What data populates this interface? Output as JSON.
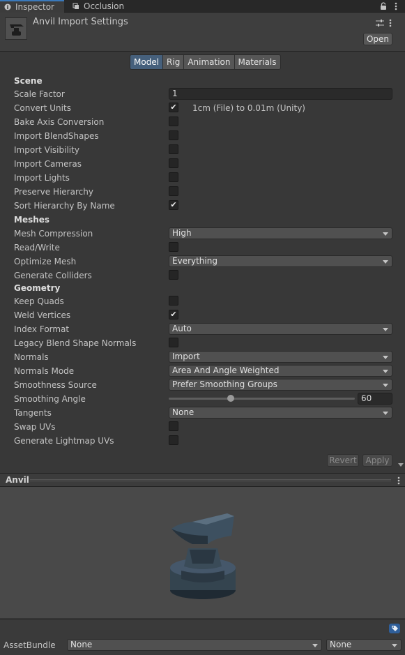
{
  "tabs": [
    {
      "label": "Inspector",
      "icon": "info-icon"
    },
    {
      "label": "Occlusion",
      "icon": "occlusion-icon"
    }
  ],
  "header": {
    "title": "Anvil Import Settings",
    "open_label": "Open"
  },
  "model_tabs": [
    "Model",
    "Rig",
    "Animation",
    "Materials"
  ],
  "selected_tab": "Model",
  "sections": {
    "scene": "Scene",
    "meshes": "Meshes",
    "geometry": "Geometry"
  },
  "scene": {
    "scale_factor_label": "Scale Factor",
    "scale_factor_value": "1",
    "convert_units_label": "Convert Units",
    "convert_units_checked": true,
    "convert_units_note": "1cm (File) to 0.01m (Unity)",
    "bake_axis_label": "Bake Axis Conversion",
    "bake_axis_checked": false,
    "import_blendshapes_label": "Import BlendShapes",
    "import_blendshapes_checked": false,
    "import_visibility_label": "Import Visibility",
    "import_visibility_checked": false,
    "import_cameras_label": "Import Cameras",
    "import_cameras_checked": false,
    "import_lights_label": "Import Lights",
    "import_lights_checked": false,
    "preserve_hierarchy_label": "Preserve Hierarchy",
    "preserve_hierarchy_checked": false,
    "sort_hierarchy_label": "Sort Hierarchy By Name",
    "sort_hierarchy_checked": true
  },
  "meshes": {
    "compression_label": "Mesh Compression",
    "compression_value": "High",
    "read_write_label": "Read/Write",
    "read_write_checked": false,
    "optimize_label": "Optimize Mesh",
    "optimize_value": "Everything",
    "colliders_label": "Generate Colliders",
    "colliders_checked": false
  },
  "geometry": {
    "keep_quads_label": "Keep Quads",
    "keep_quads_checked": false,
    "weld_label": "Weld Vertices",
    "weld_checked": true,
    "index_format_label": "Index Format",
    "index_format_value": "Auto",
    "legacy_blend_label": "Legacy Blend Shape Normals",
    "legacy_blend_checked": false,
    "normals_label": "Normals",
    "normals_value": "Import",
    "normals_mode_label": "Normals Mode",
    "normals_mode_value": "Area And Angle Weighted",
    "smoothness_source_label": "Smoothness Source",
    "smoothness_source_value": "Prefer Smoothing Groups",
    "smoothing_angle_label": "Smoothing Angle",
    "smoothing_angle_value": "60",
    "smoothing_angle_fraction": 0.333,
    "tangents_label": "Tangents",
    "tangents_value": "None",
    "swap_uvs_label": "Swap UVs",
    "swap_uvs_checked": false,
    "lightmap_uvs_label": "Generate Lightmap UVs",
    "lightmap_uvs_checked": false
  },
  "footer": {
    "revert_label": "Revert",
    "apply_label": "Apply"
  },
  "preview": {
    "title": "Anvil"
  },
  "asset_bundle": {
    "label": "AssetBundle",
    "name_value": "None",
    "variant_value": "None"
  },
  "colors": {
    "accent": "#3a79bb",
    "selected_tab": "#46607c",
    "panel": "#383838"
  }
}
